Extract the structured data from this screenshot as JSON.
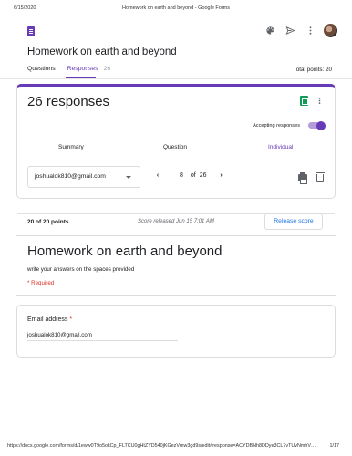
{
  "print": {
    "date": "6/15/2020",
    "title": "Homework on earth and beyond - Google Forms",
    "url": "https://docs.google.com/forms/d/1eww0T9o5okCp_FLTCU0gHtZYD540jKGezVmw3gd9s/edit#response=ACYDBNh8DDye3CL7vTUvNmhVGyEIK...",
    "page": "1/17"
  },
  "header": {
    "doc_title": "Homework on earth and beyond",
    "icons": [
      "forms-logo-icon",
      "palette-icon",
      "send-icon",
      "more-vert-icon",
      "avatar"
    ]
  },
  "tabs": {
    "questions": "Questions",
    "responses": "Responses",
    "responses_count": "26",
    "total_points": "Total points: 20"
  },
  "responses_card": {
    "heading": "26 responses",
    "accepting_label": "Accepting responses",
    "accepting_on": true,
    "subtabs": {
      "summary": "Summary",
      "question": "Question",
      "individual": "Individual"
    },
    "selected_email": "joshualok810@gmail.com",
    "pager": {
      "current": "8",
      "of": "of",
      "total": "26"
    }
  },
  "score": {
    "points": "20 of 20 points",
    "released": "Score released Jun 15 7:01 AM",
    "release_button": "Release score"
  },
  "form": {
    "title": "Homework on earth and beyond",
    "description": "write your answers on the spaces provided",
    "required_note": "* Required"
  },
  "question": {
    "label": "Email address",
    "required_mark": "*",
    "answer": "joshualok810@gmail.com"
  },
  "colors": {
    "accent": "#673ab7",
    "link": "#1a73e8",
    "required": "#d93025",
    "sheets": "#0f9d58"
  }
}
